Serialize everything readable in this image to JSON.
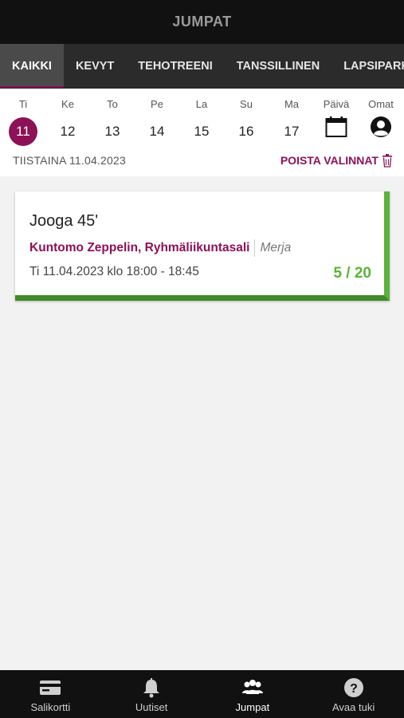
{
  "header": {
    "title": "JUMPAT"
  },
  "tabs": [
    {
      "label": "KAIKKI",
      "active": true
    },
    {
      "label": "KEVYT"
    },
    {
      "label": "TEHOTREENI"
    },
    {
      "label": "TANSSILLINEN"
    },
    {
      "label": "LAPSIPARKKI"
    }
  ],
  "calendar": {
    "days": [
      {
        "label": "Ti",
        "num": "11",
        "selected": true
      },
      {
        "label": "Ke",
        "num": "12"
      },
      {
        "label": "To",
        "num": "13"
      },
      {
        "label": "Pe",
        "num": "14"
      },
      {
        "label": "La",
        "num": "15"
      },
      {
        "label": "Su",
        "num": "16"
      },
      {
        "label": "Ma",
        "num": "17"
      }
    ],
    "day_picker_label": "Päivä",
    "own_label": "Omat",
    "selected_date_text": "TIISTAINA 11.04.2023",
    "clear_label": "POISTA VALINNAT"
  },
  "classes": [
    {
      "title": "Jooga 45'",
      "location": "Kuntomo Zeppelin, Ryhmäliikuntasali",
      "instructor": "Merja",
      "time": "Ti 11.04.2023 klo 18:00 - 18:45",
      "count": "5 / 20"
    }
  ],
  "bottom_nav": [
    {
      "label": "Salikortti",
      "icon": "card-icon"
    },
    {
      "label": "Uutiset",
      "icon": "bell-icon"
    },
    {
      "label": "Jumpat",
      "icon": "group-icon",
      "active": true
    },
    {
      "label": "Avaa tuki",
      "icon": "help-icon"
    }
  ],
  "colors": {
    "accent": "#8c1157",
    "available": "#5ab33a",
    "bar_dark": "#111111",
    "tab_bar": "#2b2b2b"
  }
}
